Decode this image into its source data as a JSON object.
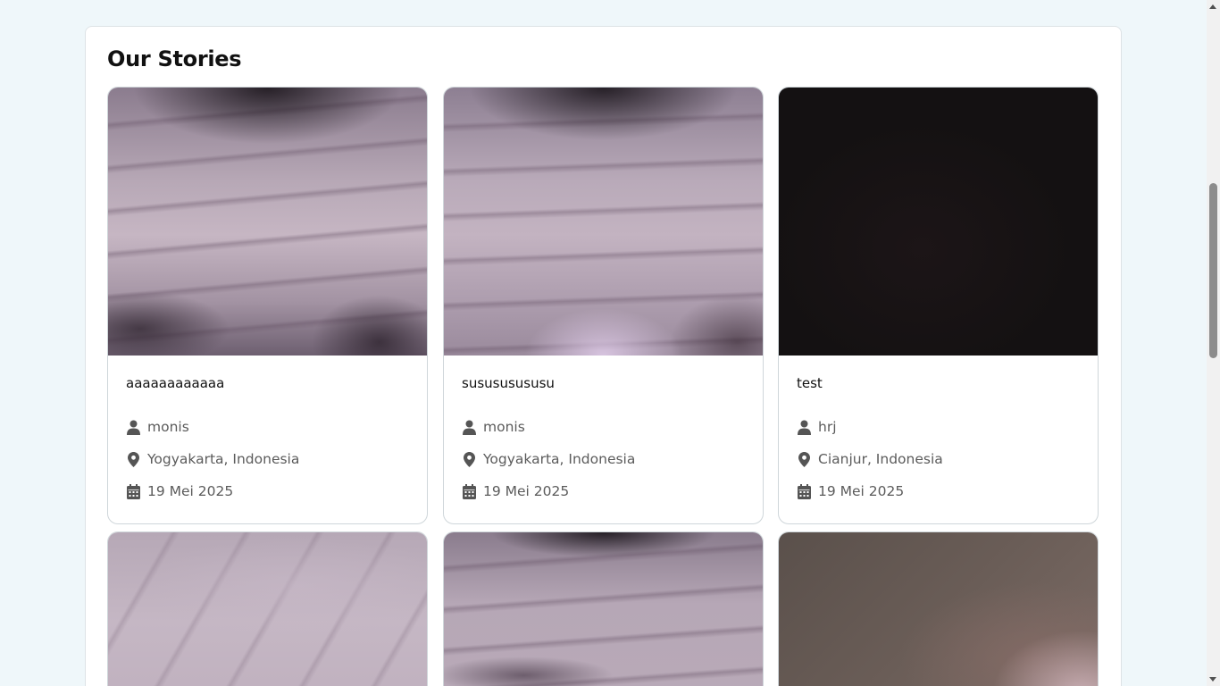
{
  "section": {
    "title": "Our Stories"
  },
  "stories": [
    {
      "name": "aaaaaaaaaaaa",
      "author": "monis",
      "location": "Yogyakarta, Indonesia",
      "date": "19 Mei 2025"
    },
    {
      "name": "susususususu",
      "author": "monis",
      "location": "Yogyakarta, Indonesia",
      "date": "19 Mei 2025"
    },
    {
      "name": "test",
      "author": "hrj",
      "location": "Cianjur, Indonesia",
      "date": "19 Mei 2025"
    }
  ],
  "icons": {
    "author": "user-icon",
    "location": "map-pin-icon",
    "date": "calendar-icon"
  },
  "colors": {
    "page_bg": "#eff7fa",
    "card_border": "#cfd6da",
    "meta_text": "#5b5b5b",
    "icon": "#555555"
  }
}
